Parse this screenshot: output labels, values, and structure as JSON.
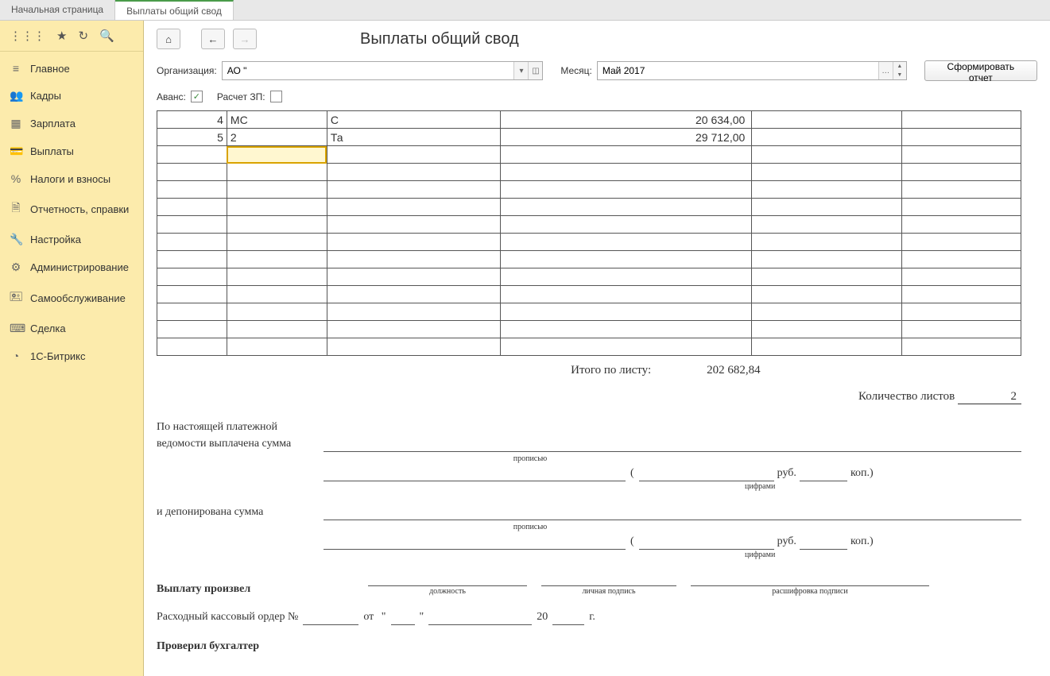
{
  "tabs": {
    "home": "Начальная страница",
    "current": "Выплаты общий свод"
  },
  "sidebar": {
    "items": [
      {
        "icon": "≡",
        "label": "Главное"
      },
      {
        "icon": "👥",
        "label": "Кадры"
      },
      {
        "icon": "▦",
        "label": "Зарплата"
      },
      {
        "icon": "💳",
        "label": "Выплаты"
      },
      {
        "icon": "%",
        "label": "Налоги и взносы"
      },
      {
        "icon": "🗎",
        "label": "Отчетность, справки"
      },
      {
        "icon": "🔧",
        "label": "Настройка"
      },
      {
        "icon": "⚙",
        "label": "Администрирование"
      },
      {
        "icon": "🖭",
        "label": "Самообслуживание"
      },
      {
        "icon": "⌨",
        "label": "Сделка"
      },
      {
        "icon": "◔",
        "label": "1С-Битрикс"
      }
    ]
  },
  "header": {
    "title": "Выплаты общий свод"
  },
  "filters": {
    "org_label": "Организация:",
    "org_value": "АО \"",
    "month_label": "Месяц:",
    "month_value": "Май 2017",
    "report_btn": "Сформировать отчет",
    "avans_label": "Аванс:",
    "raschet_label": "Расчет ЗП:"
  },
  "rows": [
    {
      "n": "4",
      "a": "МС",
      "b": "С",
      "sum": "20 634,00"
    },
    {
      "n": "5",
      "a": "2",
      "b": "Та",
      "sum": "29 712,00"
    }
  ],
  "summary": {
    "itogo_label": "Итого по листу:",
    "itogo_value": "202 682,84",
    "sheets_label": "Количество листов",
    "sheets_value": "2",
    "paid_text1": "По настоящей платежной",
    "paid_text2": "ведомости выплачена сумма",
    "propis": "прописью",
    "rub": "руб.",
    "kop": "коп.)",
    "tsifr": "цифрами",
    "depon": "и депонирована сумма",
    "payer": "Выплату произвел",
    "dolzh": "должность",
    "sign": "личная подпись",
    "rasshifr": "расшифровка подписи",
    "order": "Расходный кассовый ордер №",
    "ot": "от",
    "y20": "20",
    "god": "г.",
    "check": "Проверил бухгалтер"
  }
}
